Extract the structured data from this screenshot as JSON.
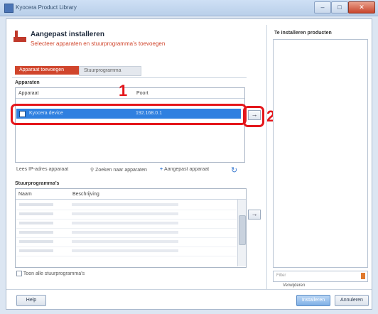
{
  "window": {
    "title": "Kyocera Product Library",
    "controls": [
      "–",
      "□",
      "✕"
    ]
  },
  "header": {
    "title": "Aangepast installeren",
    "subtitle": "Selecteer apparaten en stuurprogramma’s toevoegen"
  },
  "tabs": [
    {
      "label": "Apparaat toevoegen",
      "active": true
    },
    {
      "label": "Stuurprogramma",
      "active": false
    }
  ],
  "devices": {
    "section_label": "Apparaten",
    "col_name": "Apparaat",
    "col_port": "Poort",
    "selected_row": {
      "name": "Kyocera device",
      "port": "192.168.0.1"
    },
    "add_button": "→"
  },
  "device_toolbar": {
    "manual_label": "Lees IP-adres apparaat",
    "refresh_label": "Zoeken naar apparaten",
    "add_label": "Aangepast apparaat"
  },
  "drivers": {
    "section_label": "Stuurprogramma’s",
    "col_name": "Naam",
    "col_desc": "Beschrijving",
    "add_button": "→"
  },
  "right_pane": {
    "title": "Te installeren producten",
    "search_placeholder": "Filter",
    "remove_label": "Verwijderen"
  },
  "options": {
    "show_all_label": "Toon alle stuurprogramma’s"
  },
  "footer": {
    "help": "Help",
    "install": "Installeren",
    "cancel": "Annuleren"
  },
  "callouts": {
    "one": "1",
    "two": "2"
  },
  "colors": {
    "accent": "#d0452c",
    "selection": "#2f80e0",
    "callout": "#e4161b"
  }
}
